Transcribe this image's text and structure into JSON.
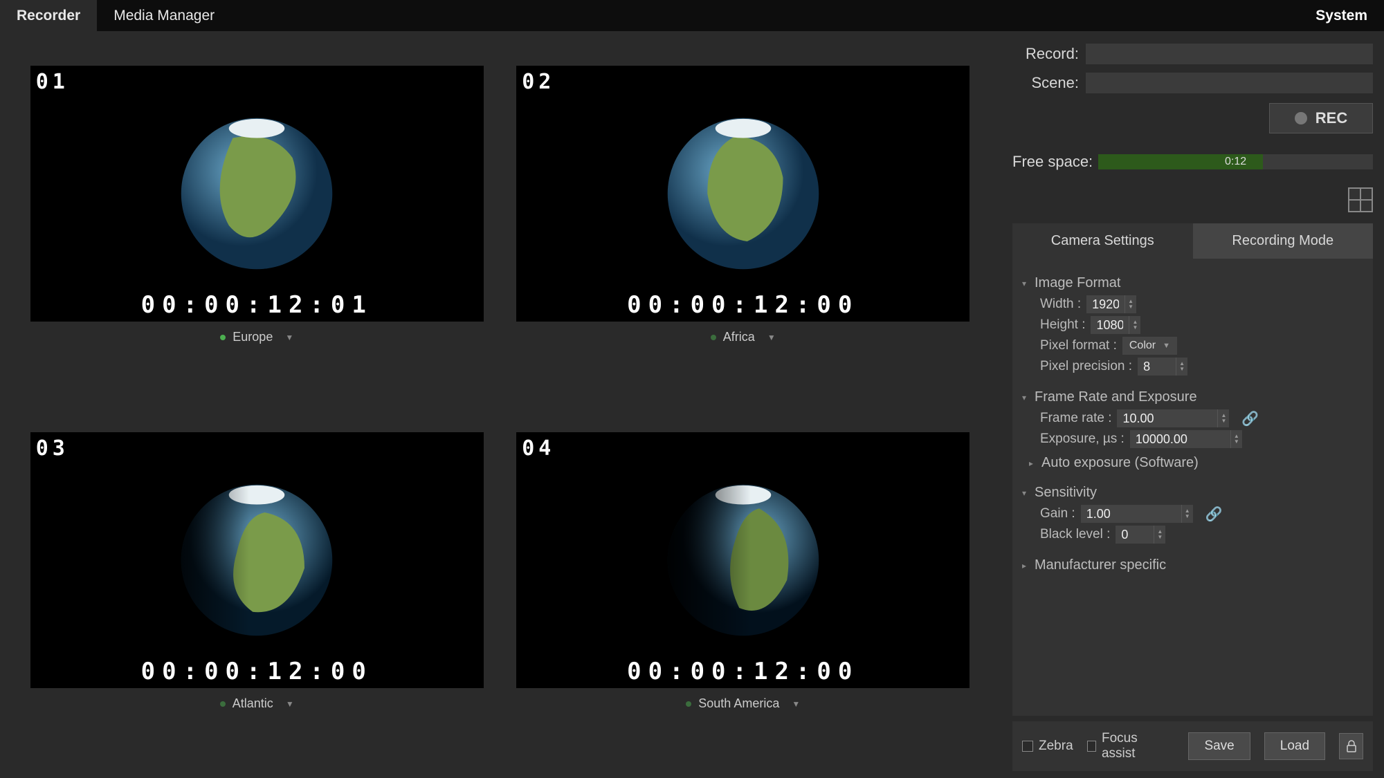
{
  "nav": {
    "tabs": [
      "Recorder",
      "Media Manager"
    ],
    "active": 0,
    "system": "System"
  },
  "cameras": [
    {
      "num": "01",
      "tc": "00:00:12:01",
      "name": "Europe",
      "status": "green"
    },
    {
      "num": "02",
      "tc": "00:00:12:00",
      "name": "Africa",
      "status": "dim"
    },
    {
      "num": "03",
      "tc": "00:00:12:00",
      "name": "Atlantic",
      "status": "dim"
    },
    {
      "num": "04",
      "tc": "00:00:12:00",
      "name": "South America",
      "status": "dim"
    }
  ],
  "right": {
    "record_label": "Record:",
    "record_value": "",
    "scene_label": "Scene:",
    "scene_value": "",
    "rec_button": "REC",
    "free_space_label": "Free space:",
    "free_space_text": "0:12",
    "free_space_fill_pct": 60
  },
  "settings": {
    "tabs": [
      "Camera Settings",
      "Recording Mode"
    ],
    "active": 0,
    "image_format": {
      "title": "Image Format",
      "width_label": "Width :",
      "width": "1920",
      "height_label": "Height :",
      "height": "1080",
      "pixel_format_label": "Pixel format :",
      "pixel_format": "Color",
      "pixel_precision_label": "Pixel precision :",
      "pixel_precision": "8"
    },
    "frame_rate": {
      "title": "Frame Rate and Exposure",
      "frame_rate_label": "Frame rate :",
      "frame_rate": "10.00",
      "exposure_label": "Exposure, µs :",
      "exposure": "10000.00",
      "auto_exposure": "Auto exposure (Software)"
    },
    "sensitivity": {
      "title": "Sensitivity",
      "gain_label": "Gain :",
      "gain": "1.00",
      "black_level_label": "Black level :",
      "black_level": "0"
    },
    "manufacturer": "Manufacturer specific"
  },
  "footer": {
    "zebra": "Zebra",
    "focus_assist": "Focus assist",
    "save": "Save",
    "load": "Load"
  }
}
